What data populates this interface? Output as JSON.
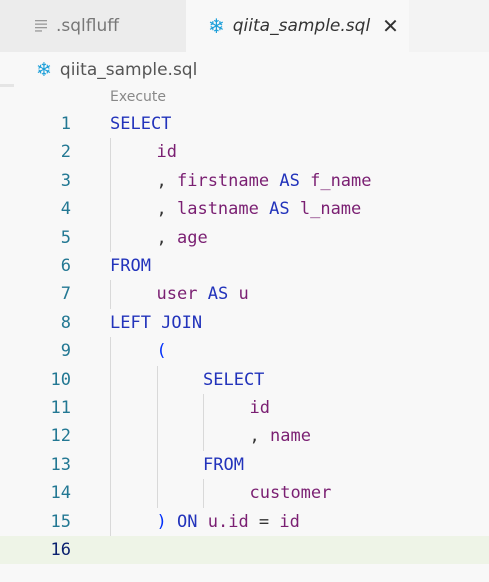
{
  "tabs": [
    {
      "label": ".sqlfluff",
      "icon": "lines-icon",
      "active": false
    },
    {
      "label": "qiita_sample.sql",
      "icon": "snowflake-icon",
      "active": true
    }
  ],
  "breadcrumb": {
    "file": "qiita_sample.sql",
    "icon": "snowflake-icon"
  },
  "codelens": {
    "label": "Execute"
  },
  "current_line": 16,
  "lines": [
    {
      "n": "1",
      "indent": 0,
      "tokens": [
        {
          "t": "SELECT",
          "c": "kw"
        }
      ]
    },
    {
      "n": "2",
      "indent": 1,
      "tokens": [
        {
          "t": "id",
          "c": "id"
        }
      ]
    },
    {
      "n": "3",
      "indent": 1,
      "tokens": [
        {
          "t": ", ",
          "c": "pn"
        },
        {
          "t": "firstname",
          "c": "id"
        },
        {
          "t": " ",
          "c": "pn"
        },
        {
          "t": "AS",
          "c": "kw"
        },
        {
          "t": " ",
          "c": "pn"
        },
        {
          "t": "f_name",
          "c": "id"
        }
      ]
    },
    {
      "n": "4",
      "indent": 1,
      "tokens": [
        {
          "t": ", ",
          "c": "pn"
        },
        {
          "t": "lastname",
          "c": "id"
        },
        {
          "t": " ",
          "c": "pn"
        },
        {
          "t": "AS",
          "c": "kw"
        },
        {
          "t": " ",
          "c": "pn"
        },
        {
          "t": "l_name",
          "c": "id"
        }
      ]
    },
    {
      "n": "5",
      "indent": 1,
      "tokens": [
        {
          "t": ", ",
          "c": "pn"
        },
        {
          "t": "age",
          "c": "id"
        }
      ]
    },
    {
      "n": "6",
      "indent": 0,
      "tokens": [
        {
          "t": "FROM",
          "c": "kw"
        }
      ]
    },
    {
      "n": "7",
      "indent": 1,
      "tokens": [
        {
          "t": "user",
          "c": "id"
        },
        {
          "t": " ",
          "c": "pn"
        },
        {
          "t": "AS",
          "c": "kw"
        },
        {
          "t": " ",
          "c": "pn"
        },
        {
          "t": "u",
          "c": "id"
        }
      ]
    },
    {
      "n": "8",
      "indent": 0,
      "tokens": [
        {
          "t": "LEFT JOIN",
          "c": "kw"
        }
      ]
    },
    {
      "n": "9",
      "indent": 1,
      "tokens": [
        {
          "t": "(",
          "c": "br"
        }
      ]
    },
    {
      "n": "10",
      "indent": 2,
      "tokens": [
        {
          "t": "SELECT",
          "c": "kw"
        }
      ]
    },
    {
      "n": "11",
      "indent": 3,
      "tokens": [
        {
          "t": "id",
          "c": "id"
        }
      ]
    },
    {
      "n": "12",
      "indent": 3,
      "tokens": [
        {
          "t": ", ",
          "c": "pn"
        },
        {
          "t": "name",
          "c": "id"
        }
      ]
    },
    {
      "n": "13",
      "indent": 2,
      "tokens": [
        {
          "t": "FROM",
          "c": "kw"
        }
      ]
    },
    {
      "n": "14",
      "indent": 3,
      "tokens": [
        {
          "t": "customer",
          "c": "id"
        }
      ]
    },
    {
      "n": "15",
      "indent": 1,
      "tokens": [
        {
          "t": ")",
          "c": "br"
        },
        {
          "t": " ",
          "c": "pn"
        },
        {
          "t": "ON",
          "c": "kw"
        },
        {
          "t": " ",
          "c": "pn"
        },
        {
          "t": "u.id",
          "c": "id"
        },
        {
          "t": " = ",
          "c": "pn"
        },
        {
          "t": "id",
          "c": "id"
        }
      ]
    },
    {
      "n": "16",
      "indent": 0,
      "tokens": []
    }
  ]
}
